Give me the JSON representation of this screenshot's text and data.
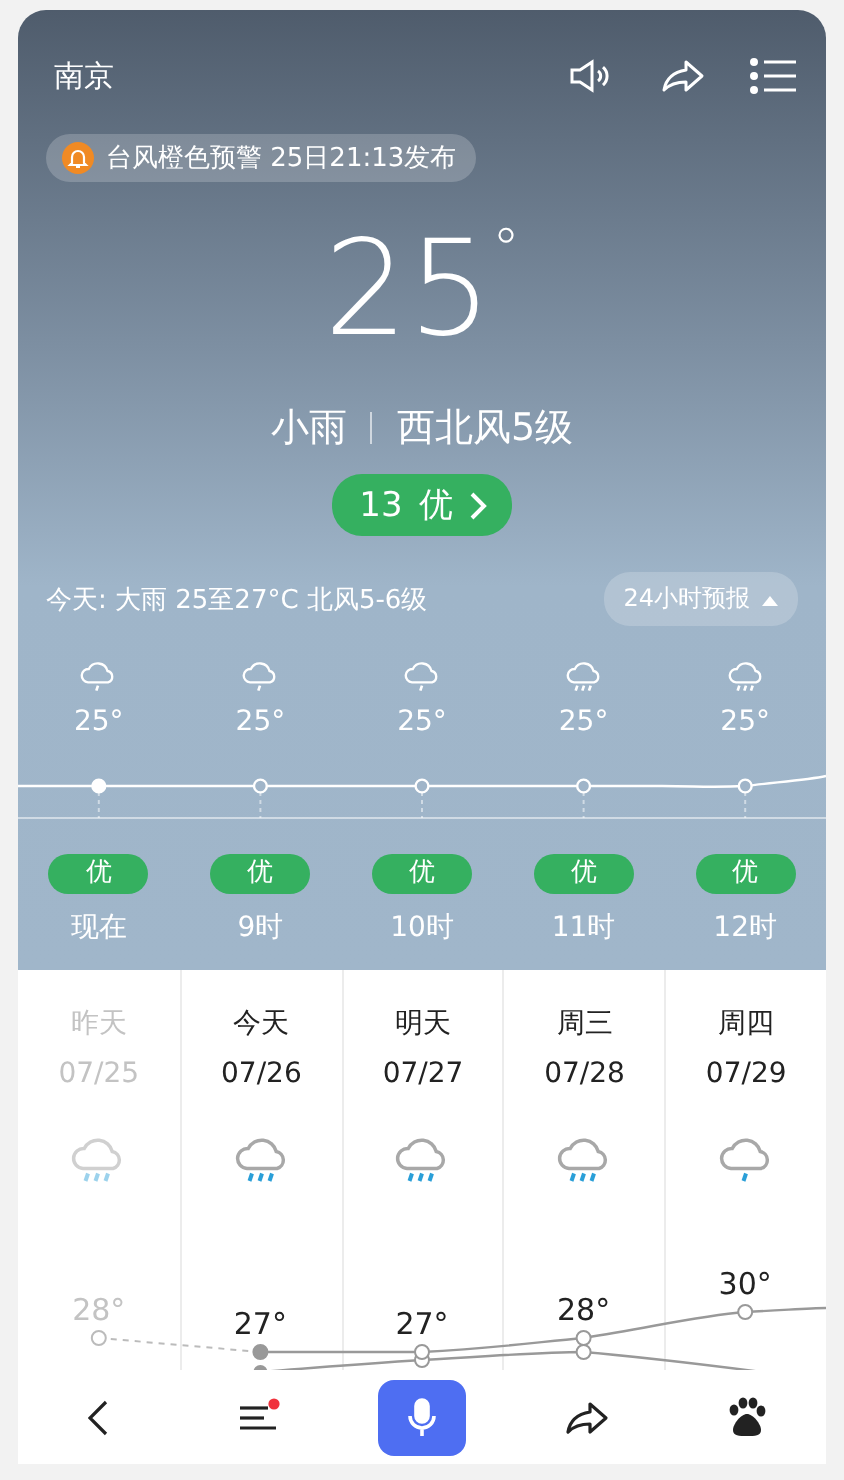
{
  "header": {
    "city": "南京"
  },
  "alert": {
    "text": "台风橙色预警 25日21:13发布"
  },
  "current": {
    "temperature": "25",
    "unit": "°",
    "condition": "小雨",
    "wind": "西北风5级",
    "aqi": {
      "value": "13",
      "label": "优"
    }
  },
  "today_summary": "今天: 大雨 25至27°C 北风5-6级",
  "forecast_toggle": {
    "label": "24小时预报",
    "expanded": true
  },
  "hourly": [
    {
      "kind": "light_rain",
      "temp": "25°",
      "aqi": "优",
      "time": "现在",
      "current": true
    },
    {
      "kind": "light_rain",
      "temp": "25°",
      "aqi": "优",
      "time": "9时",
      "current": false
    },
    {
      "kind": "light_rain",
      "temp": "25°",
      "aqi": "优",
      "time": "10时",
      "current": false
    },
    {
      "kind": "rain",
      "temp": "25°",
      "aqi": "优",
      "time": "11时",
      "current": false
    },
    {
      "kind": "rain",
      "temp": "25°",
      "aqi": "优",
      "time": "12时",
      "current": false
    }
  ],
  "daily": [
    {
      "day": "昨天",
      "date": "07/25",
      "kind": "rain",
      "high": "28°",
      "past": true
    },
    {
      "day": "今天",
      "date": "07/26",
      "kind": "rain",
      "high": "27°",
      "past": false
    },
    {
      "day": "明天",
      "date": "07/27",
      "kind": "rain",
      "high": "27°",
      "past": false
    },
    {
      "day": "周三",
      "date": "07/28",
      "kind": "rain",
      "high": "28°",
      "past": false
    },
    {
      "day": "周四",
      "date": "07/29",
      "kind": "light_rain",
      "high": "30°",
      "past": false
    }
  ]
}
